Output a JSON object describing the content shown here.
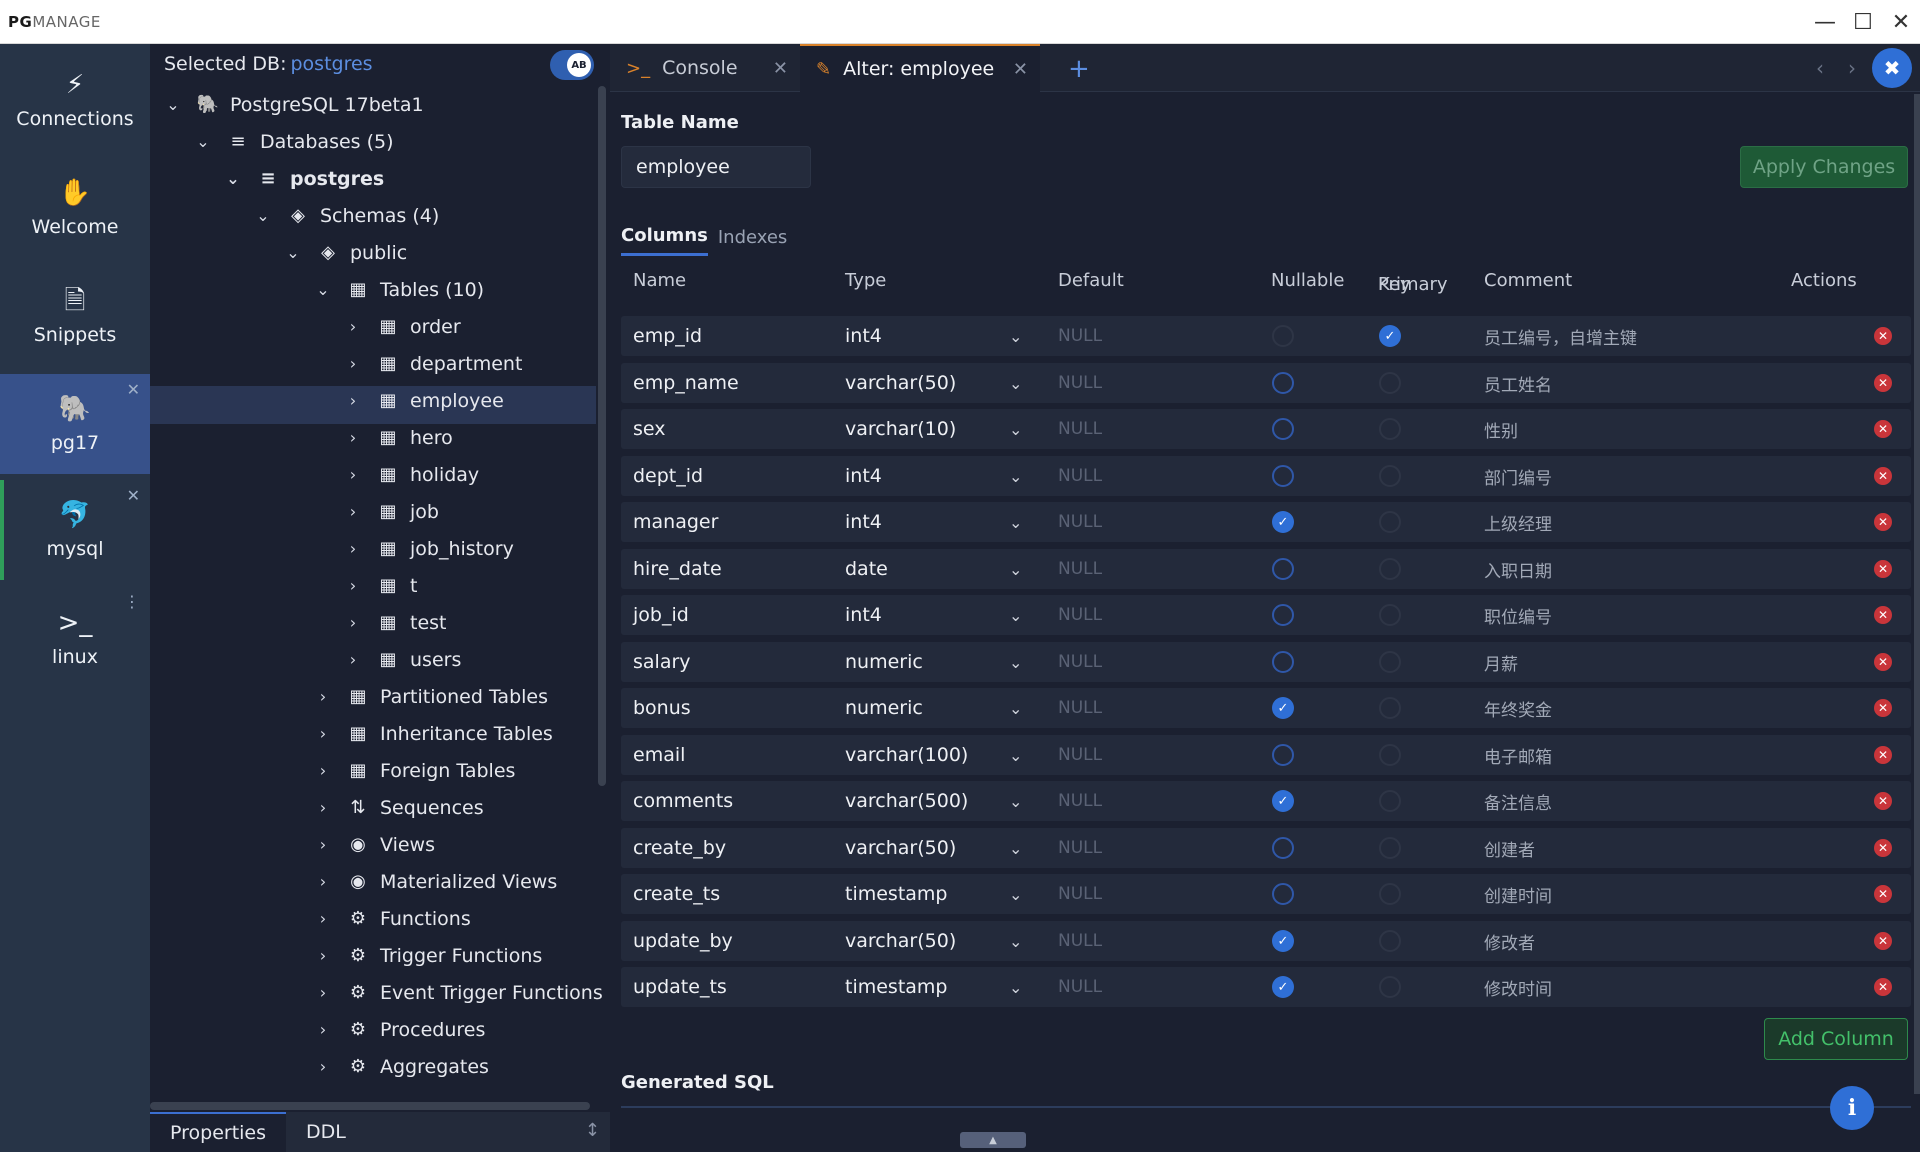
{
  "app": {
    "brand_bold": "PG",
    "brand_rest": "MANAGE"
  },
  "window_controls": {
    "minimize": "—",
    "maximize": "☐",
    "close": "✕"
  },
  "rail": [
    {
      "label": "Connections",
      "icon": "⚡"
    },
    {
      "label": "Welcome",
      "icon": "✋"
    },
    {
      "label": "Snippets",
      "icon": "🗎"
    },
    {
      "label": "pg17",
      "icon": "🐘"
    },
    {
      "label": "mysql",
      "icon": "🐬"
    },
    {
      "label": "linux",
      "icon": ">_"
    }
  ],
  "tree_panel": {
    "selected_db_label": "Selected DB:",
    "selected_db_name": "postgres",
    "toggle_label": "AB",
    "nodes": [
      {
        "label": "PostgreSQL 17beta1",
        "icon": "🐘",
        "chev": "⌄"
      },
      {
        "label": "Databases (5)",
        "icon": "≡",
        "chev": "⌄"
      },
      {
        "label": "postgres",
        "icon": "≡",
        "chev": "⌄"
      },
      {
        "label": "Schemas (4)",
        "icon": "◈",
        "chev": "⌄"
      },
      {
        "label": "public",
        "icon": "◈",
        "chev": "⌄"
      },
      {
        "label": "Tables (10)",
        "icon": "▦",
        "chev": "⌄"
      },
      {
        "label": "order",
        "icon": "▦",
        "chev": "›"
      },
      {
        "label": "department",
        "icon": "▦",
        "chev": "›"
      },
      {
        "label": "employee",
        "icon": "▦",
        "chev": "›"
      },
      {
        "label": "hero",
        "icon": "▦",
        "chev": "›"
      },
      {
        "label": "holiday",
        "icon": "▦",
        "chev": "›"
      },
      {
        "label": "job",
        "icon": "▦",
        "chev": "›"
      },
      {
        "label": "job_history",
        "icon": "▦",
        "chev": "›"
      },
      {
        "label": "t",
        "icon": "▦",
        "chev": "›"
      },
      {
        "label": "test",
        "icon": "▦",
        "chev": "›"
      },
      {
        "label": "users",
        "icon": "▦",
        "chev": "›"
      },
      {
        "label": "Partitioned Tables",
        "icon": "▦",
        "chev": "›"
      },
      {
        "label": "Inheritance Tables",
        "icon": "▦",
        "chev": "›"
      },
      {
        "label": "Foreign Tables",
        "icon": "▦",
        "chev": "›"
      },
      {
        "label": "Sequences",
        "icon": "⇅",
        "chev": "›"
      },
      {
        "label": "Views",
        "icon": "◉",
        "chev": "›"
      },
      {
        "label": "Materialized Views",
        "icon": "◉",
        "chev": "›"
      },
      {
        "label": "Functions",
        "icon": "⚙",
        "chev": "›"
      },
      {
        "label": "Trigger Functions",
        "icon": "⚙",
        "chev": "›"
      },
      {
        "label": "Event Trigger Functions",
        "icon": "⚙",
        "chev": "›"
      },
      {
        "label": "Procedures",
        "icon": "⚙",
        "chev": "›"
      },
      {
        "label": "Aggregates",
        "icon": "⚙",
        "chev": "›"
      }
    ],
    "bottom_tabs": [
      "Properties",
      "DDL"
    ]
  },
  "tabs": [
    {
      "label": "Console",
      "icon": ">_"
    },
    {
      "label": "Alter: employee",
      "icon": "✎"
    }
  ],
  "editor": {
    "table_name_label": "Table Name",
    "table_name_value": "employee",
    "apply_label": "Apply Changes",
    "subtabs": [
      "Columns",
      "Indexes"
    ],
    "headers": {
      "name": "Name",
      "type": "Type",
      "default": "Default",
      "nullable": "Nullable",
      "primary_key_1": "Primary",
      "primary_key_2": "Key",
      "comment": "Comment",
      "actions": "Actions"
    },
    "rows": [
      {
        "name": "emp_id",
        "type": "int4",
        "default": "NULL",
        "nullable": false,
        "pk": true,
        "comment": "员工编号，自增主键"
      },
      {
        "name": "emp_name",
        "type": "varchar(50)",
        "default": "NULL",
        "nullable": false,
        "pk": false,
        "comment": "员工姓名"
      },
      {
        "name": "sex",
        "type": "varchar(10)",
        "default": "NULL",
        "nullable": false,
        "pk": false,
        "comment": "性别"
      },
      {
        "name": "dept_id",
        "type": "int4",
        "default": "NULL",
        "nullable": false,
        "pk": false,
        "comment": "部门编号"
      },
      {
        "name": "manager",
        "type": "int4",
        "default": "NULL",
        "nullable": true,
        "pk": false,
        "comment": "上级经理"
      },
      {
        "name": "hire_date",
        "type": "date",
        "default": "NULL",
        "nullable": false,
        "pk": false,
        "comment": "入职日期"
      },
      {
        "name": "job_id",
        "type": "int4",
        "default": "NULL",
        "nullable": false,
        "pk": false,
        "comment": "职位编号"
      },
      {
        "name": "salary",
        "type": "numeric",
        "default": "NULL",
        "nullable": false,
        "pk": false,
        "comment": "月薪"
      },
      {
        "name": "bonus",
        "type": "numeric",
        "default": "NULL",
        "nullable": true,
        "pk": false,
        "comment": "年终奖金"
      },
      {
        "name": "email",
        "type": "varchar(100)",
        "default": "NULL",
        "nullable": false,
        "pk": false,
        "comment": "电子邮箱"
      },
      {
        "name": "comments",
        "type": "varchar(500)",
        "default": "NULL",
        "nullable": true,
        "pk": false,
        "comment": "备注信息"
      },
      {
        "name": "create_by",
        "type": "varchar(50)",
        "default": "NULL",
        "nullable": false,
        "pk": false,
        "comment": "创建者"
      },
      {
        "name": "create_ts",
        "type": "timestamp",
        "default": "NULL",
        "nullable": false,
        "pk": false,
        "comment": "创建时间"
      },
      {
        "name": "update_by",
        "type": "varchar(50)",
        "default": "NULL",
        "nullable": true,
        "pk": false,
        "comment": "修改者"
      },
      {
        "name": "update_ts",
        "type": "timestamp",
        "default": "NULL",
        "nullable": true,
        "pk": false,
        "comment": "修改时间"
      }
    ],
    "add_column_label": "Add Column",
    "generated_sql_label": "Generated SQL"
  }
}
